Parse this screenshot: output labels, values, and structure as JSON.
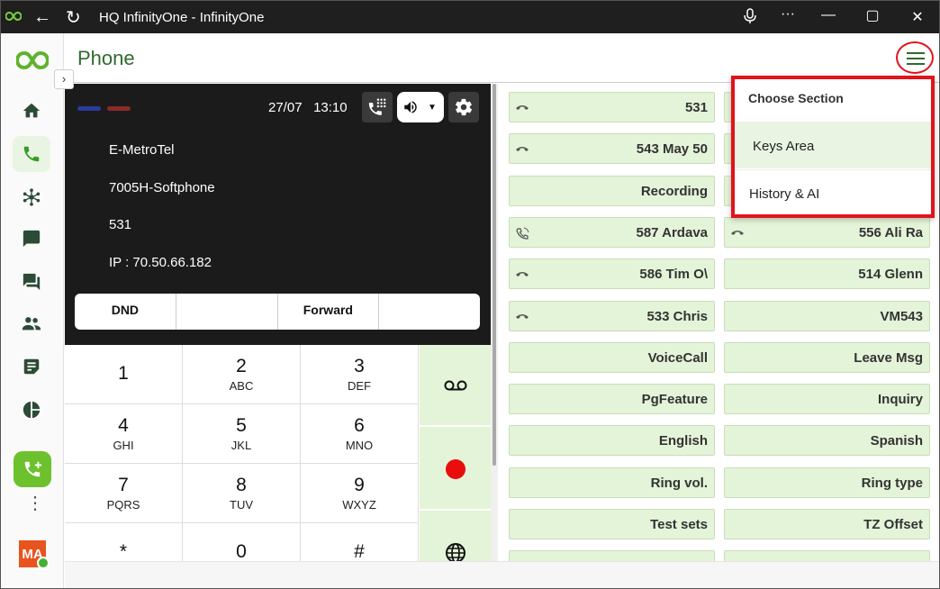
{
  "titlebar": {
    "title": "HQ InfinityOne - InfinityOne",
    "back_icon": "arrow-left-icon",
    "reload_icon": "reload-icon",
    "mic_icon": "microphone-icon",
    "more_glyph": "···",
    "minimize_glyph": "—",
    "maximize_glyph": "▢",
    "close_glyph": "✕"
  },
  "header": {
    "title": "Phone"
  },
  "rail": {
    "items": [
      "home-icon",
      "phone-icon",
      "hub-icon",
      "chat-icon",
      "forum-icon",
      "people-icon",
      "notes-icon",
      "pie-chart-icon"
    ],
    "active": "phone-icon",
    "avatar_initials": "MA",
    "toggle_glyph": "›",
    "dots_glyph": "⋮"
  },
  "phone": {
    "date": "27/07",
    "time": "13:10",
    "line_name": "E-MetroTel",
    "device": "7005H-Softphone",
    "extension": "531",
    "ip": "IP : 70.50.66.182",
    "softkeys": [
      "DND",
      "",
      "Forward",
      ""
    ],
    "led_colors": [
      "#2c3a9c",
      "#8a2a2a"
    ]
  },
  "dialpad": [
    {
      "num": "1",
      "letters": ""
    },
    {
      "num": "2",
      "letters": "ABC"
    },
    {
      "num": "3",
      "letters": "DEF"
    },
    {
      "num": "4",
      "letters": "GHI"
    },
    {
      "num": "5",
      "letters": "JKL"
    },
    {
      "num": "6",
      "letters": "MNO"
    },
    {
      "num": "7",
      "letters": "PQRS"
    },
    {
      "num": "8",
      "letters": "TUV"
    },
    {
      "num": "9",
      "letters": "WXYZ"
    },
    {
      "num": "*",
      "letters": ""
    },
    {
      "num": "0",
      "letters": ""
    },
    {
      "num": "#",
      "letters": ""
    }
  ],
  "side_buttons": [
    "voicemail-icon",
    "record-icon",
    "globe-icon"
  ],
  "keys": [
    {
      "label": "531",
      "icon": "handset-icon"
    },
    {
      "label": "",
      "icon": "handset-icon"
    },
    {
      "label": "543 May 50",
      "icon": "handset-icon"
    },
    {
      "label": "",
      "icon": ""
    },
    {
      "label": "Recording",
      "icon": ""
    },
    {
      "label": "",
      "icon": ""
    },
    {
      "label": "587 Ardava",
      "icon": "phone-ring-icon"
    },
    {
      "label": "556 Ali Ra",
      "icon": "handset-icon"
    },
    {
      "label": "586 Tim O\\",
      "icon": "handset-icon"
    },
    {
      "label": "514 Glenn",
      "icon": ""
    },
    {
      "label": "533 Chris",
      "icon": "handset-icon"
    },
    {
      "label": "VM543",
      "icon": ""
    },
    {
      "label": "VoiceCall",
      "icon": ""
    },
    {
      "label": "Leave Msg",
      "icon": ""
    },
    {
      "label": "PgFeature",
      "icon": ""
    },
    {
      "label": "Inquiry",
      "icon": ""
    },
    {
      "label": "English",
      "icon": ""
    },
    {
      "label": "Spanish",
      "icon": ""
    },
    {
      "label": "Ring vol.",
      "icon": ""
    },
    {
      "label": "Ring type",
      "icon": ""
    },
    {
      "label": "Test sets",
      "icon": ""
    },
    {
      "label": "TZ Offset",
      "icon": ""
    },
    {
      "label": "",
      "icon": ""
    },
    {
      "label": "",
      "icon": ""
    }
  ],
  "dropdown": {
    "heading": "Choose Section",
    "items": [
      "Keys Area",
      "History & AI"
    ],
    "selected": "Keys Area"
  },
  "colors": {
    "accent": "#2f6b2c",
    "key_bg": "#e4f4d8",
    "highlight": "#e2131b",
    "record": "#e80e0e",
    "call_button": "#6cc12c"
  }
}
